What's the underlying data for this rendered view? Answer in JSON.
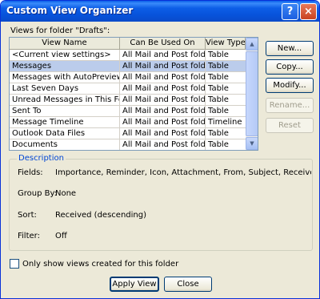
{
  "window": {
    "title": "Custom View Organizer",
    "help": "?",
    "close": "×"
  },
  "views_label": "Views for folder \"Drafts\":",
  "columns": [
    "View Name",
    "Can Be Used On",
    "View Type"
  ],
  "rows": [
    {
      "name": "<Current view settings>",
      "used_on": "All Mail and Post folders",
      "type": "Table"
    },
    {
      "name": "Messages",
      "used_on": "All Mail and Post folders",
      "type": "Table"
    },
    {
      "name": "Messages with AutoPreview",
      "used_on": "All Mail and Post folders",
      "type": "Table"
    },
    {
      "name": "Last Seven Days",
      "used_on": "All Mail and Post folders",
      "type": "Table"
    },
    {
      "name": "Unread Messages in This Folder",
      "used_on": "All Mail and Post folders",
      "type": "Table"
    },
    {
      "name": "Sent To",
      "used_on": "All Mail and Post folders",
      "type": "Table"
    },
    {
      "name": "Message Timeline",
      "used_on": "All Mail and Post folders",
      "type": "Timeline"
    },
    {
      "name": "Outlook Data Files",
      "used_on": "All Mail and Post folders",
      "type": "Table"
    },
    {
      "name": "Documents",
      "used_on": "All Mail and Post folders",
      "type": "Table"
    }
  ],
  "selected_row": 1,
  "buttons": {
    "new": "New...",
    "copy": "Copy...",
    "modify": "Modify...",
    "rename": "Rename...",
    "reset": "Reset",
    "apply": "Apply View",
    "close": "Close"
  },
  "description": {
    "title": "Description",
    "fields_label": "Fields:",
    "fields_value": "Importance, Reminder, Icon, Attachment, From, Subject, Received, Size, Categ",
    "groupby_label": "Group By:",
    "groupby_value": "None",
    "sort_label": "Sort:",
    "sort_value": "Received (descending)",
    "filter_label": "Filter:",
    "filter_value": "Off"
  },
  "only_show_label": "Only show views created for this folder",
  "only_show_checked": false
}
